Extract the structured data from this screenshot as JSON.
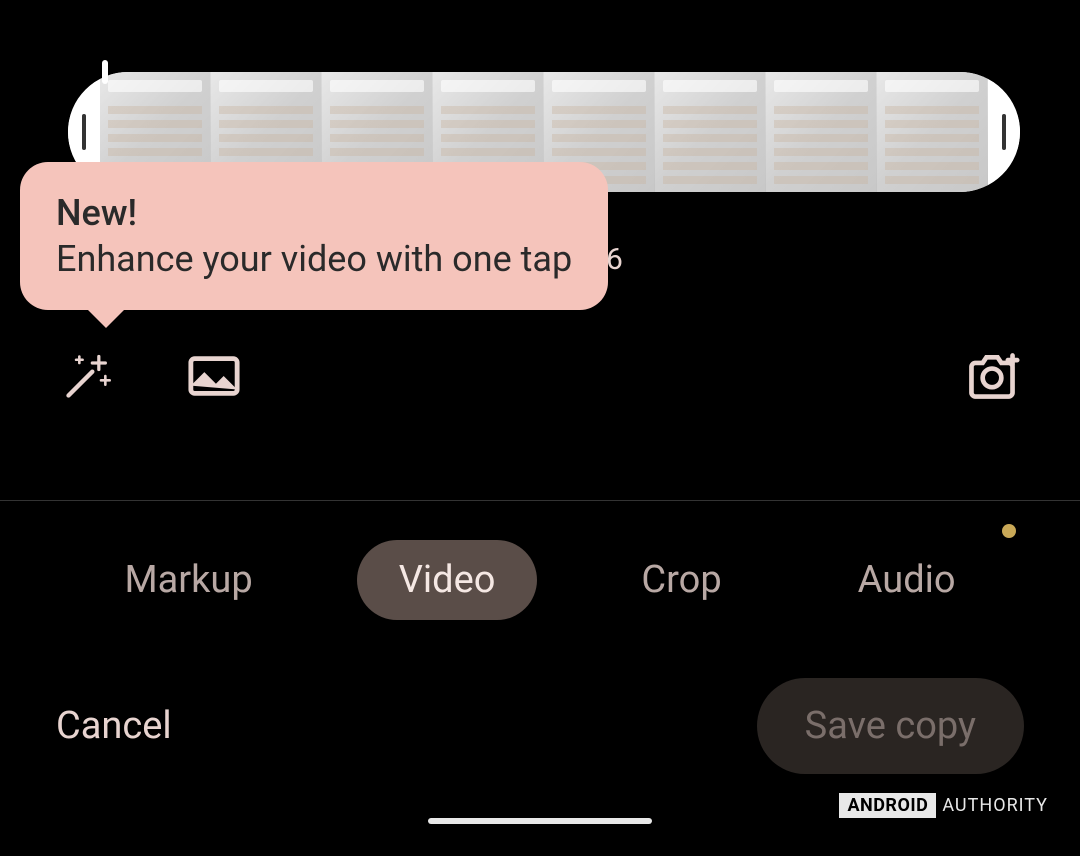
{
  "tooltip": {
    "title": "New!",
    "text": "Enhance your video with one tap"
  },
  "timeline": {
    "time_label_partial": "6"
  },
  "tabs": {
    "markup": "Markup",
    "video": "Video",
    "crop": "Crop",
    "audio": "Audio",
    "active": "video",
    "audio_has_dot": true
  },
  "actions": {
    "cancel": "Cancel",
    "save": "Save copy"
  },
  "icons": {
    "enhance": "magic-wand-icon",
    "frame": "frame-photo-icon",
    "camera_add": "camera-add-icon"
  },
  "watermark": {
    "brand": "ANDROID",
    "suffix": "AUTHORITY"
  },
  "colors": {
    "tooltip_bg": "#f5c4bb",
    "tab_active_bg": "#5a4d48",
    "save_bg": "#2a2522",
    "accent_dot": "#c9a857"
  }
}
